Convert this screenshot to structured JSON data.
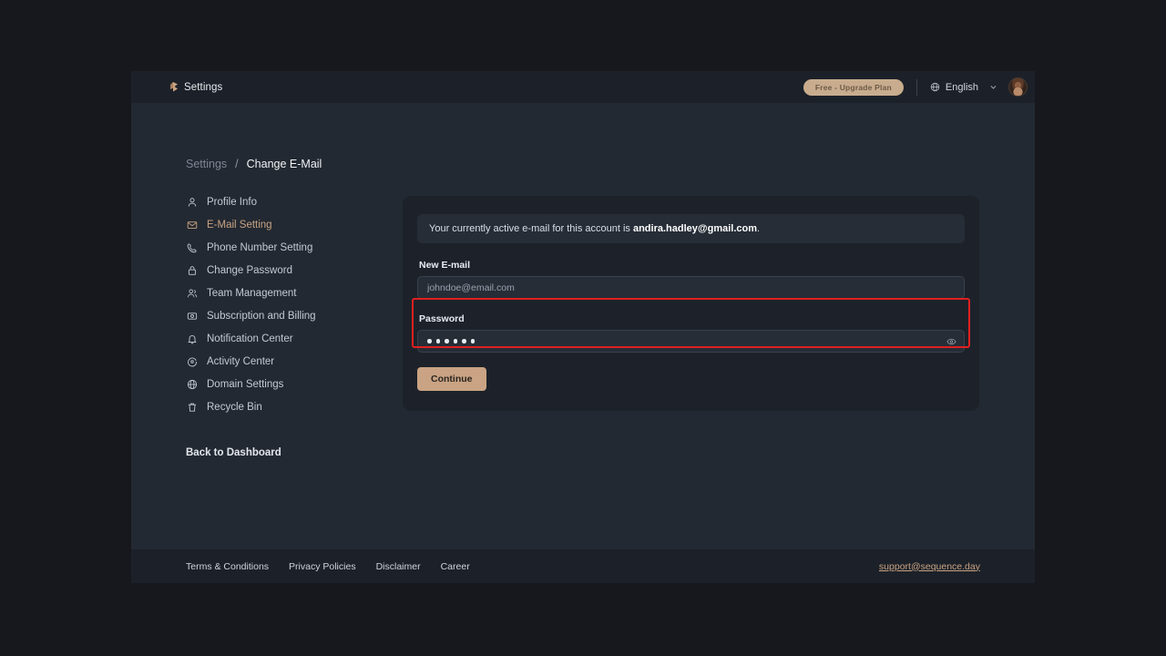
{
  "header": {
    "logo_icon": "sequence-logo-icon",
    "title": "Settings",
    "plan_badge": "Free - Upgrade Plan",
    "globe_icon": "globe-icon",
    "language": "English",
    "chevron_icon": "chevron-down-icon",
    "avatar_alt": "user-avatar"
  },
  "breadcrumb": {
    "root": "Settings",
    "separator": "/",
    "current": "Change E-Mail"
  },
  "sidebar": {
    "items": [
      {
        "label": "Profile Info",
        "icon": "user-icon",
        "active": false
      },
      {
        "label": "E-Mail Setting",
        "icon": "mail-icon",
        "active": true
      },
      {
        "label": "Phone Number Setting",
        "icon": "phone-icon",
        "active": false
      },
      {
        "label": "Change Password",
        "icon": "lock-icon",
        "active": false
      },
      {
        "label": "Team Management",
        "icon": "users-icon",
        "active": false
      },
      {
        "label": "Subscription and Billing",
        "icon": "credit-card-icon",
        "active": false
      },
      {
        "label": "Notification Center",
        "icon": "bell-icon",
        "active": false
      },
      {
        "label": "Activity Center",
        "icon": "activity-icon",
        "active": false
      },
      {
        "label": "Domain Settings",
        "icon": "globe-icon",
        "active": false
      },
      {
        "label": "Recycle Bin",
        "icon": "trash-icon",
        "active": false
      }
    ],
    "back_to_dashboard": "Back to Dashboard"
  },
  "main": {
    "info_prefix": "Your currently active e-mail for this account is ",
    "info_email": "andira.hadley@gmail.com",
    "info_suffix": ".",
    "email_label": "New E-mail",
    "email_placeholder": "johndoe@email.com",
    "email_value": "",
    "password_label": "Password",
    "password_dots": 6,
    "password_value": "••••••",
    "eye_icon": "eye-icon",
    "continue_label": "Continue",
    "highlight_color": "#e02020"
  },
  "footer": {
    "links": [
      "Terms & Conditions",
      "Privacy Policies",
      "Disclaimer",
      "Career"
    ],
    "support_email": "support@sequence.day"
  },
  "colors": {
    "accent": "#c9a383",
    "panel": "#232932",
    "header": "#1c2129",
    "card": "#1d222a",
    "input": "#262d37",
    "page": "#16181d"
  }
}
